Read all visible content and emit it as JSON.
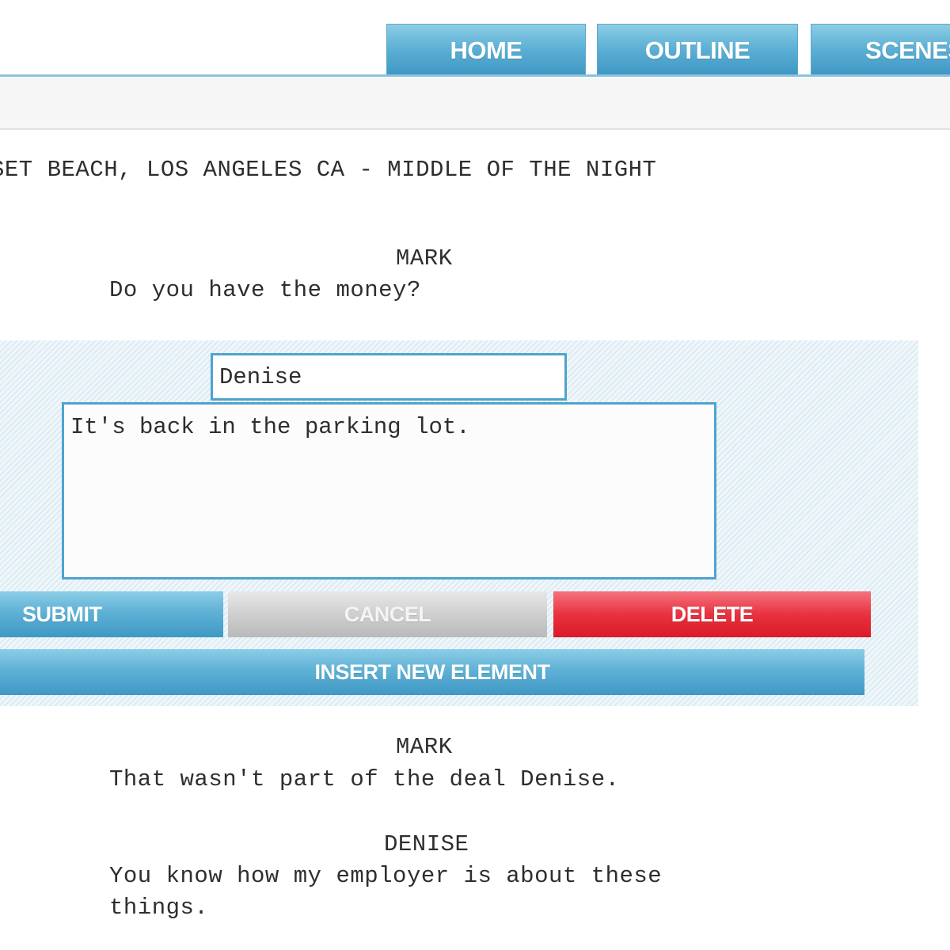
{
  "nav": {
    "tabs": [
      {
        "label": "HOME"
      },
      {
        "label": "OUTLINE"
      },
      {
        "label": "SCENES"
      }
    ]
  },
  "script": {
    "slugline": "SET BEACH, LOS ANGELES CA - MIDDLE OF THE NIGHT",
    "blocks": [
      {
        "character": "MARK",
        "dialogue": [
          "Do you have the money?"
        ]
      },
      {
        "character": "MARK",
        "dialogue": [
          "That wasn't part of the deal Denise."
        ]
      },
      {
        "character": "DENISE",
        "dialogue": [
          "You know how my employer is about these",
          "things."
        ]
      }
    ]
  },
  "editor": {
    "character_value": "Denise",
    "dialogue_value": "It's back in the parking lot.",
    "buttons": {
      "submit": "SUBMIT",
      "cancel": "CANCEL",
      "delete": "DELETE",
      "insert": "INSERT NEW ELEMENT"
    }
  },
  "colors": {
    "accent_blue": "#4fa3cf",
    "delete_red": "#e8323f",
    "cancel_grey": "#cfcfcf"
  }
}
